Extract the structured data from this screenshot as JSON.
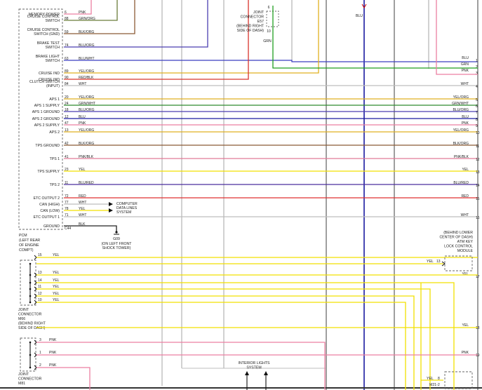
{
  "colors": {
    "PNK": "#ec7fa2",
    "GRN/ORG": "#6b7d3a",
    "BLK/ORG": "#8b5a35",
    "BLU/ORG": "#4b3fb0",
    "BLU/WHT": "#3b3fc0",
    "YEL/ORG": "#e0b020",
    "RED/BLK": "#d8342c",
    "WHT": "#bdbdbd",
    "GRN/WHT": "#2f8a2f",
    "BLU": "#1a1aa0",
    "YEL": "#f2e000",
    "PNK/BLK": "#e07a96",
    "BLU/RED": "#4a2d9e",
    "RED": "#e03030",
    "BLK": "#222222",
    "GRN": "#1f9d1f"
  },
  "pcm": {
    "pins": [
      {
        "label": "MEMORY POWER",
        "num": "6",
        "wire": "PNK"
      },
      {
        "label": "CRUISE CONTROL|SWITCH",
        "num": "88",
        "wire": "GRN/ORG"
      },
      {
        "label": "CRUISE CONTROL|SWITCH (GND)",
        "num": "59",
        "wire": "BLK/ORG"
      },
      {
        "label": "BRAKE TEST|SWITCH",
        "num": "74",
        "wire": "BLU/ORG"
      },
      {
        "label": "BRAKE LIGHT|SWITCH",
        "num": "63",
        "wire": "BLU/WHT"
      },
      {
        "label": "CRUISE IND",
        "num": "89",
        "wire": "YEL/ORG"
      },
      {
        "label": "CRUISE IND",
        "num": "90",
        "wire": "RED/BLK"
      },
      {
        "label": "CLUTCH SWITCH|(INPUT)",
        "num": "84",
        "wire": "WHT"
      },
      {
        "label": "APS 1",
        "num": "20",
        "wire": "YEL/ORG"
      },
      {
        "label": "APS 1 SUPPLY",
        "num": "24",
        "wire": "GRN/WHT"
      },
      {
        "label": "APS 1 GROUND",
        "num": "18",
        "wire": "BLU/ORG"
      },
      {
        "label": "APS 2 GROUND",
        "num": "12",
        "wire": "BLU"
      },
      {
        "label": "APS 2 SUPPLY",
        "num": "47",
        "wire": "PNK"
      },
      {
        "label": "APS 2",
        "num": "13",
        "wire": "YEL/ORG"
      },
      {
        "label": "TPS GROUND",
        "num": "42",
        "wire": "BLK/ORG"
      },
      {
        "label": "TPS 1",
        "num": "41",
        "wire": "PNK/BLK"
      },
      {
        "label": "TPS SUPPLY",
        "num": "23",
        "wire": "YEL"
      },
      {
        "label": "TPS 2",
        "num": "11",
        "wire": "BLU/RED"
      },
      {
        "label": "ETC OUTPUT 2",
        "num": "72",
        "wire": "RED"
      },
      {
        "label": "CAN (HIGH)",
        "num": "77",
        "wire": "WHT"
      },
      {
        "label": "CAN (LOW)",
        "num": "78",
        "wire": "YEL"
      },
      {
        "label": "ETC OUTPUT 1",
        "num": "71",
        "wire": "WHT"
      },
      {
        "label": "GROUND",
        "num": "",
        "wire": "BLK"
      }
    ],
    "c44": "C44",
    "caption": [
      "PCM",
      "(LEFT REAR",
      "OF ENGINE",
      "COMPT)"
    ]
  },
  "computer_data_lines": [
    "COMPUTER",
    "DATA LINES",
    "SYSTEM"
  ],
  "ground": {
    "id": "G09",
    "note": [
      "(ON LEFT FRONT",
      "SHOCK TOWER)"
    ]
  },
  "e57": {
    "lines": [
      "JOINT",
      "CONNECTOR",
      "E57",
      "(BEHIND RIGHT",
      "SIDE OF DASH)"
    ],
    "pin_top": "6",
    "pin_bottom": "10",
    "wire": "GRN"
  },
  "blu_label": "BLU",
  "right_wires": [
    {
      "wire": "BLU",
      "num": "1"
    },
    {
      "wire": "GRN",
      "num": "2"
    },
    {
      "wire": "PNK",
      "num": "3"
    },
    {
      "wire": "WHT",
      "num": "4"
    },
    {
      "wire": "YEL/ORG",
      "num": "5"
    },
    {
      "wire": "GRN/WHT",
      "num": "6"
    },
    {
      "wire": "BLU/ORG",
      "num": "7"
    },
    {
      "wire": "BLU",
      "num": "8"
    },
    {
      "wire": "PNK",
      "num": "9"
    },
    {
      "wire": "YEL/ORG",
      "num": "10"
    },
    {
      "wire": "BLK/ORG",
      "num": "11"
    },
    {
      "wire": "PNK/BLK",
      "num": "12"
    },
    {
      "wire": "YEL",
      "num": "13"
    },
    {
      "wire": "BLU/RED",
      "num": "14"
    },
    {
      "wire": "RED",
      "num": "15"
    },
    {
      "wire": "WHT",
      "num": "16"
    },
    {
      "wire": "YEL",
      "num": "17"
    },
    {
      "wire": "YEL",
      "num": "18"
    },
    {
      "wire": "PNK",
      "num": "19"
    }
  ],
  "atm": {
    "lines": [
      "(BEHIND LOWER",
      "CENTER OF DASH)",
      "ATM KEY",
      "LOCK CONTROL",
      "MODULE"
    ],
    "wire": "YEL",
    "pin": "13"
  },
  "m66": {
    "pins": [
      {
        "num": "15",
        "wire": "YEL"
      },
      {
        "num": "13",
        "wire": "YEL"
      },
      {
        "num": "14",
        "wire": "YEL"
      },
      {
        "num": "11",
        "wire": "YEL"
      },
      {
        "num": "12",
        "wire": "YEL"
      },
      {
        "num": "10",
        "wire": "YEL"
      }
    ],
    "lines": [
      "JOINT",
      "CONNECTOR",
      "M66",
      "(BEHIND RIGHT",
      "SIDE OF DASH)"
    ]
  },
  "m81": {
    "pins": [
      {
        "num": "3",
        "wire": "PNK"
      },
      {
        "num": "1",
        "wire": "PNK"
      },
      {
        "num": "2",
        "wire": "PNK"
      }
    ],
    "lines": [
      "JOINT",
      "CONNECTOR",
      "M81"
    ]
  },
  "interior_lights": [
    "INTERIOR LIGHTS",
    "SYSTEM"
  ],
  "m21": {
    "wire": "YEL",
    "pin": "8",
    "label": "M21-2"
  }
}
